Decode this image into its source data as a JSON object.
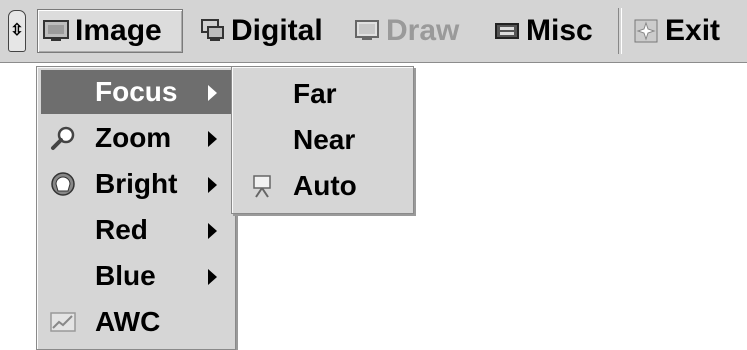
{
  "toolbar": {
    "items": [
      {
        "label": "Image",
        "icon": "monitor-icon",
        "state": "active"
      },
      {
        "label": "Digital",
        "icon": "digital-icon",
        "state": "normal"
      },
      {
        "label": "Draw",
        "icon": "draw-monitor-icon",
        "state": "disabled"
      },
      {
        "label": "Misc",
        "icon": "printer-icon",
        "state": "normal"
      },
      {
        "label": "Exit",
        "icon": "exit-icon",
        "state": "normal"
      }
    ]
  },
  "image_menu": {
    "items": [
      {
        "label": "Focus",
        "icon": "",
        "submenu": true,
        "highlighted": true
      },
      {
        "label": "Zoom",
        "icon": "magnifier-icon",
        "submenu": true
      },
      {
        "label": "Bright",
        "icon": "bright-icon",
        "submenu": true
      },
      {
        "label": "Red",
        "icon": "",
        "submenu": true
      },
      {
        "label": "Blue",
        "icon": "",
        "submenu": true
      },
      {
        "label": "AWC",
        "icon": "awc-chart-icon",
        "submenu": false
      }
    ]
  },
  "focus_submenu": {
    "items": [
      {
        "label": "Far",
        "icon": ""
      },
      {
        "label": "Near",
        "icon": ""
      },
      {
        "label": "Auto",
        "icon": "projector-icon"
      }
    ]
  },
  "colors": {
    "toolbar_bg": "#d4d4d4",
    "menu_bg": "#d6d6d6",
    "highlight_bg": "#6e6e6e",
    "disabled_text": "#9a9a9a"
  }
}
